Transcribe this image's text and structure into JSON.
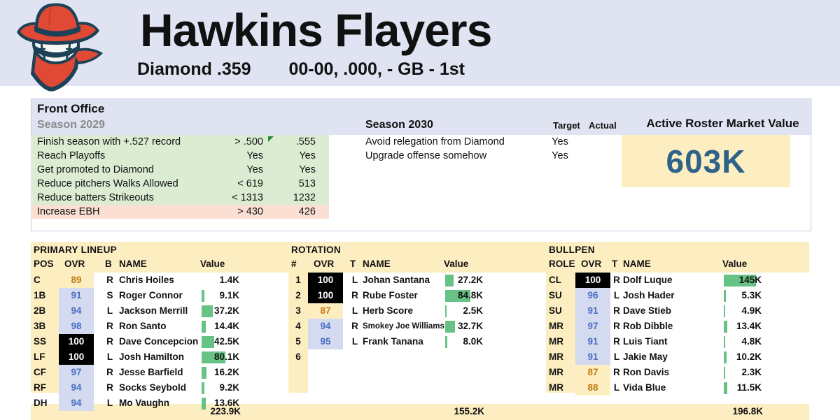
{
  "header": {
    "team_name": "Hawkins Flayers",
    "league": "Diamond .359",
    "record": "00-00, .000, - GB - 1st",
    "logo_icon": "cowboy-baseball-logo"
  },
  "front_office": {
    "panel_title": "Front Office",
    "season_prev_label": "Season 2029",
    "season_cur_label": "Season 2030",
    "target_header": "Target",
    "actual_header": "Actual",
    "market_value_title": "Active Roster Market Value",
    "market_value": "603K",
    "prev_goals": [
      {
        "label": "Finish season with +.527 record",
        "target": "> .500",
        "actual": ".555",
        "status": "ok",
        "flag": true
      },
      {
        "label": "Reach Playoffs",
        "target": "Yes",
        "actual": "Yes",
        "status": "ok",
        "flag": false
      },
      {
        "label": "Get promoted to Diamond",
        "target": "Yes",
        "actual": "Yes",
        "status": "ok",
        "flag": false
      },
      {
        "label": "Reduce pitchers Walks Allowed",
        "target": "< 619",
        "actual": "513",
        "status": "ok",
        "flag": false
      },
      {
        "label": "Reduce batters Strikeouts",
        "target": "< 1313",
        "actual": "1232",
        "status": "ok",
        "flag": false
      },
      {
        "label": "Increase EBH",
        "target": "> 430",
        "actual": "426",
        "status": "bad",
        "flag": false
      }
    ],
    "cur_goals": [
      {
        "label": "Avoid relegation from Diamond",
        "target": "Yes",
        "actual": ""
      },
      {
        "label": "Upgrade offense somehow",
        "target": "Yes",
        "actual": ""
      }
    ]
  },
  "lineup": {
    "section_title": "PRIMARY LINEUP",
    "columns": {
      "pos": "POS",
      "ovr": "OVR",
      "hand": "B",
      "name": "NAME",
      "value": "Value"
    },
    "total": "223.9K",
    "rows": [
      {
        "pos": "C",
        "ovr": "89",
        "tier": "low",
        "hand": "R",
        "name": "Chris Hoiles",
        "value": "1.4K",
        "bar": 0
      },
      {
        "pos": "1B",
        "ovr": "91",
        "tier": "mid",
        "hand": "S",
        "name": "Roger Connor",
        "value": "9.1K",
        "bar": 4
      },
      {
        "pos": "2B",
        "ovr": "94",
        "tier": "mid",
        "hand": "L",
        "name": "Jackson Merrill",
        "value": "37.2K",
        "bar": 16
      },
      {
        "pos": "3B",
        "ovr": "98",
        "tier": "mid",
        "hand": "R",
        "name": "Ron Santo",
        "value": "14.4K",
        "bar": 6
      },
      {
        "pos": "SS",
        "ovr": "100",
        "tier": "max",
        "hand": "R",
        "name": "Dave Concepcion",
        "value": "42.5K",
        "bar": 18
      },
      {
        "pos": "LF",
        "ovr": "100",
        "tier": "max",
        "hand": "L",
        "name": "Josh Hamilton",
        "value": "80.1K",
        "bar": 34
      },
      {
        "pos": "CF",
        "ovr": "97",
        "tier": "mid",
        "hand": "R",
        "name": "Jesse Barfield",
        "value": "16.2K",
        "bar": 7
      },
      {
        "pos": "RF",
        "ovr": "94",
        "tier": "mid",
        "hand": "R",
        "name": "Socks Seybold",
        "value": "9.2K",
        "bar": 4
      },
      {
        "pos": "DH",
        "ovr": "94",
        "tier": "mid",
        "hand": "L",
        "name": "Mo Vaughn",
        "value": "13.6K",
        "bar": 6
      }
    ]
  },
  "rotation": {
    "section_title": "ROTATION",
    "columns": {
      "pos": "#",
      "ovr": "OVR",
      "hand": "T",
      "name": "NAME",
      "value": "Value"
    },
    "total": "155.2K",
    "rows": [
      {
        "pos": "1",
        "ovr": "100",
        "tier": "max",
        "hand": "L",
        "name": "Johan Santana",
        "value": "27.2K",
        "bar": 12,
        "small": false
      },
      {
        "pos": "2",
        "ovr": "100",
        "tier": "max",
        "hand": "R",
        "name": "Rube Foster",
        "value": "84.8K",
        "bar": 36,
        "small": false
      },
      {
        "pos": "3",
        "ovr": "87",
        "tier": "low",
        "hand": "L",
        "name": "Herb Score",
        "value": "2.5K",
        "bar": 2,
        "small": false
      },
      {
        "pos": "4",
        "ovr": "94",
        "tier": "mid",
        "hand": "R",
        "name": "Smokey Joe Williams",
        "value": "32.7K",
        "bar": 14,
        "small": true
      },
      {
        "pos": "5",
        "ovr": "95",
        "tier": "mid",
        "hand": "L",
        "name": "Frank Tanana",
        "value": "8.0K",
        "bar": 3,
        "small": false
      },
      {
        "pos": "6",
        "ovr": "",
        "tier": "none",
        "hand": "",
        "name": "",
        "value": "",
        "bar": 0,
        "small": false
      }
    ]
  },
  "bullpen": {
    "section_title": "BULLPEN",
    "columns": {
      "pos": "ROLE",
      "ovr": "OVR",
      "hand": "T",
      "name": "NAME",
      "value": "Value"
    },
    "total": "196.8K",
    "rows": [
      {
        "pos": "CL",
        "ovr": "100",
        "tier": "max",
        "hand": "R",
        "name": "Dolf Luque",
        "value": "145K",
        "bar": 46
      },
      {
        "pos": "SU",
        "ovr": "96",
        "tier": "mid",
        "hand": "L",
        "name": "Josh Hader",
        "value": "5.3K",
        "bar": 3
      },
      {
        "pos": "SU",
        "ovr": "91",
        "tier": "mid",
        "hand": "R",
        "name": "Dave Stieb",
        "value": "4.9K",
        "bar": 2
      },
      {
        "pos": "MR",
        "ovr": "97",
        "tier": "mid",
        "hand": "R",
        "name": "Rob Dibble",
        "value": "13.4K",
        "bar": 5
      },
      {
        "pos": "MR",
        "ovr": "91",
        "tier": "mid",
        "hand": "R",
        "name": "Luis Tiant",
        "value": "4.8K",
        "bar": 2
      },
      {
        "pos": "MR",
        "ovr": "91",
        "tier": "mid",
        "hand": "L",
        "name": "Jakie May",
        "value": "10.2K",
        "bar": 4
      },
      {
        "pos": "MR",
        "ovr": "87",
        "tier": "low",
        "hand": "R",
        "name": "Ron Davis",
        "value": "2.3K",
        "bar": 2
      },
      {
        "pos": "MR",
        "ovr": "88",
        "tier": "low",
        "hand": "L",
        "name": "Vida Blue",
        "value": "11.5K",
        "bar": 5
      }
    ]
  },
  "colors": {
    "banner_bg": "#dfe3f2",
    "cream": "#fdeec2",
    "green_bar": "#66c285",
    "goal_ok": "#dcecd3",
    "goal_bad": "#fadfd2",
    "value_text": "#2e6389",
    "ovr_mid_bg": "#d4daf0",
    "logo_red": "#e04a34",
    "logo_navy": "#1d4157"
  }
}
